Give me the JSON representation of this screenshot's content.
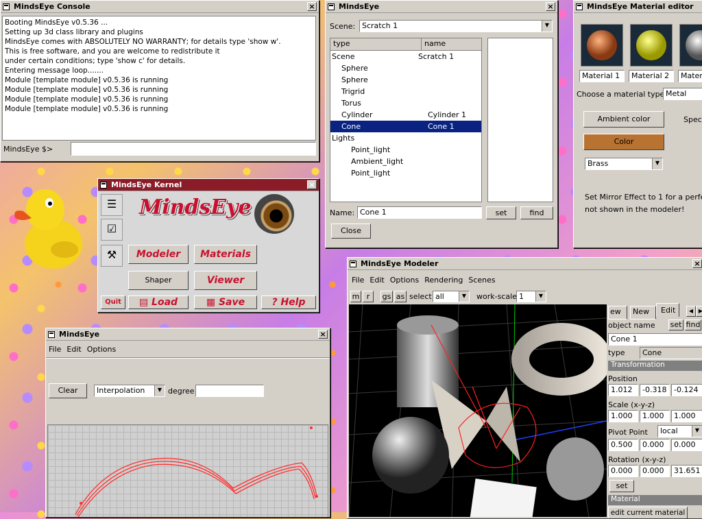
{
  "console": {
    "title": "MindsEye Console",
    "lines": [
      "Booting MindsEye v0.5.36 ...",
      "Setting up 3d class library and plugins",
      "MindsEye comes with ABSOLUTELY NO WARRANTY; for details type 'show w'.",
      "This is free software, and you are welcome to redistribute it",
      "under certain conditions; type 'show c' for details.",
      "Entering message loop.......",
      "Module [template module] v0.5.36 is running",
      "Module [template module] v0.5.36 is running",
      "Module [template module] v0.5.36 is running",
      "Module [template module] v0.5.36 is running"
    ],
    "prompt": "MindsEye $>"
  },
  "scene_win": {
    "title": "MindsEye",
    "scene_label": "Scene:",
    "scene_value": "Scratch 1",
    "col_type": "type",
    "col_name": "name",
    "rows": [
      {
        "type": "Scene",
        "name": "Scratch 1"
      },
      {
        "type": "Sphere",
        "name": ""
      },
      {
        "type": "Sphere",
        "name": ""
      },
      {
        "type": "Trigrid",
        "name": ""
      },
      {
        "type": "Torus",
        "name": ""
      },
      {
        "type": "Cylinder",
        "name": "Cylinder 1"
      },
      {
        "type": "Cone",
        "name": "Cone 1"
      },
      {
        "type": "Lights",
        "name": ""
      },
      {
        "type": "Point_light",
        "name": ""
      },
      {
        "type": "Ambient_light",
        "name": ""
      },
      {
        "type": "Point_light",
        "name": ""
      }
    ],
    "name_label": "Name:",
    "name_value": "Cone 1",
    "set": "set",
    "find": "find",
    "close": "Close"
  },
  "material": {
    "title": "MindsEye Material editor",
    "mats": [
      "Material 1",
      "Material 2",
      "Mater"
    ],
    "type_label": "Choose a material type",
    "type_value": "Metal",
    "ambient": "Ambient color",
    "spec": "Spec",
    "color": "Color",
    "preset": "Brass",
    "note1": "Set Mirror Effect to 1 for a perfec",
    "note2": "not shown in the modeler!"
  },
  "kernel": {
    "title": "MindsEye Kernel",
    "logo": "MindsEye",
    "modeler": "Modeler",
    "materials": "Materials",
    "shaper": "Shaper",
    "viewer": "Viewer",
    "quit": "Quit",
    "load": "Load",
    "save": "Save",
    "help": "Help"
  },
  "shaper": {
    "title": "MindsEye",
    "menu": [
      "File",
      "Edit",
      "Options"
    ],
    "clear": "Clear",
    "mode": "Interpolation",
    "degree": "degree"
  },
  "modeler": {
    "title": "MindsEye Modeler",
    "menu": [
      "File",
      "Edit",
      "Options",
      "Rendering",
      "Scenes"
    ],
    "tb_m": "m",
    "tb_r": "r",
    "tb_gs": "gs",
    "tb_as": "as",
    "select_label": "select",
    "select_value": "all",
    "scale_label": "work-scale",
    "scale_value": "1",
    "tabs": [
      "ew",
      "New",
      "Edit"
    ],
    "object_name_label": "object name",
    "set": "set",
    "find": "find",
    "object_name": "Cone 1",
    "type_label": "type",
    "type_value": "Cone",
    "transformation": "Transformation",
    "position_label": "Position",
    "position": [
      "1.012",
      "-0.318",
      "-0.124"
    ],
    "scale_label2": "Scale (x-y-z)",
    "scale": [
      "1.000",
      "1.000",
      "1.000"
    ],
    "pivot_label": "Pivot Point",
    "pivot_mode": "local",
    "pivot": [
      "0.500",
      "0.000",
      "0.000"
    ],
    "rotation_label": "Rotation (x-y-z)",
    "rotation": [
      "0.000",
      "0.000",
      "31.651"
    ],
    "set2": "set",
    "material_label": "Material",
    "edit_material": "edit current material"
  },
  "colors": {
    "selection": "#0a2282",
    "kernel_red": "#c8102e",
    "curve_red": "#ff3030"
  }
}
